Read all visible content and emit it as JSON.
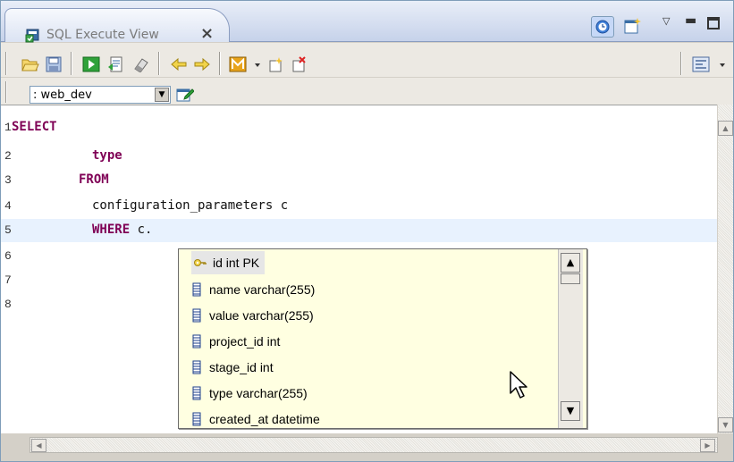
{
  "tab": {
    "title": "SQL Execute View",
    "close_icon": "×"
  },
  "connection": {
    "value": ": web_dev"
  },
  "editor": {
    "lines": [
      {
        "num": "1",
        "kw": "SELECT",
        "rest": ""
      },
      {
        "num": "2",
        "kw": "type",
        "rest": ""
      },
      {
        "num": "3",
        "kw": "FROM",
        "rest": ""
      },
      {
        "num": "4",
        "kw": "",
        "rest": "configuration_parameters c"
      },
      {
        "num": "5",
        "kw": "WHERE",
        "rest": " c."
      },
      {
        "num": "6",
        "kw": "",
        "rest": ""
      },
      {
        "num": "7",
        "kw": "",
        "rest": ""
      },
      {
        "num": "8",
        "kw": "",
        "rest": ""
      }
    ]
  },
  "autocomplete": {
    "items": [
      {
        "label": "id int PK",
        "icon": "key-icon"
      },
      {
        "label": "name varchar(255)",
        "icon": "column-icon"
      },
      {
        "label": "value varchar(255)",
        "icon": "column-icon"
      },
      {
        "label": "project_id int",
        "icon": "column-icon"
      },
      {
        "label": "stage_id int",
        "icon": "column-icon"
      },
      {
        "label": "type varchar(255)",
        "icon": "column-icon"
      },
      {
        "label": "created_at datetime",
        "icon": "column-icon"
      }
    ]
  },
  "toolbar": {
    "icons": [
      "open-folder-icon",
      "save-icon",
      "execute-icon",
      "explain-icon",
      "clear-icon",
      "back-icon",
      "forward-icon",
      "m-icon",
      "dropdown-icon",
      "new-icon",
      "close-connection-icon",
      "format-icon"
    ]
  },
  "colors": {
    "keyword": "#7f0055",
    "current_line": "#e8f2fe",
    "popup_bg": "#ffffe1"
  }
}
